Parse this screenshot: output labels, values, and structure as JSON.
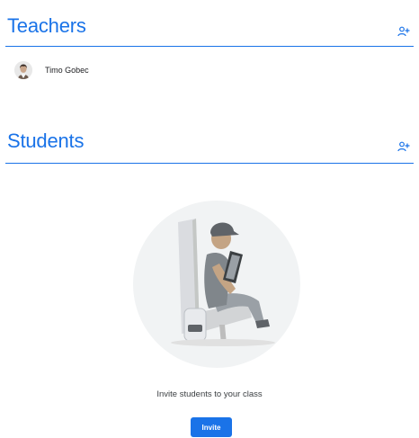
{
  "teachers": {
    "title": "Teachers",
    "add_icon": "add-person-icon",
    "members": [
      {
        "name": "Timo Gobec",
        "avatar_icon": "avatar-photo"
      }
    ]
  },
  "students": {
    "title": "Students",
    "add_icon": "add-person-icon",
    "empty_state": {
      "illustration": "student-reading-tablet-illustration",
      "message": "Invite students to your class",
      "button_label": "Invite"
    }
  },
  "colors": {
    "accent": "#1a73e8",
    "text": "#202124",
    "illustration_bg": "#f1f3f4"
  }
}
